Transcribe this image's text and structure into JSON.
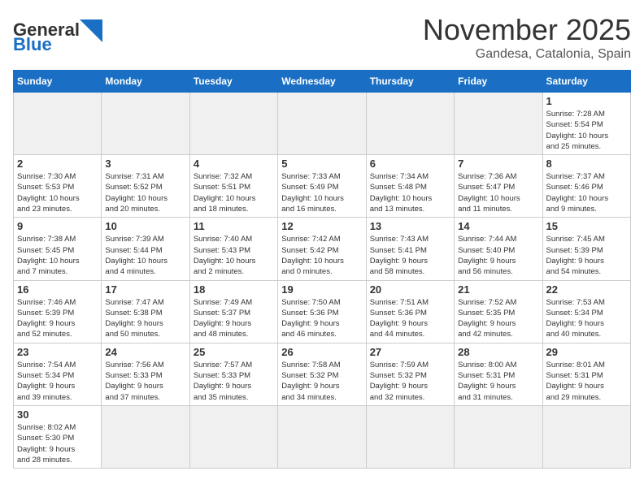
{
  "header": {
    "logo_general": "General",
    "logo_blue": "Blue",
    "month": "November 2025",
    "location": "Gandesa, Catalonia, Spain"
  },
  "weekdays": [
    "Sunday",
    "Monday",
    "Tuesday",
    "Wednesday",
    "Thursday",
    "Friday",
    "Saturday"
  ],
  "weeks": [
    [
      {
        "day": "",
        "info": "",
        "empty": true
      },
      {
        "day": "",
        "info": "",
        "empty": true
      },
      {
        "day": "",
        "info": "",
        "empty": true
      },
      {
        "day": "",
        "info": "",
        "empty": true
      },
      {
        "day": "",
        "info": "",
        "empty": true
      },
      {
        "day": "",
        "info": "",
        "empty": true
      },
      {
        "day": "1",
        "info": "Sunrise: 7:28 AM\nSunset: 5:54 PM\nDaylight: 10 hours\nand 25 minutes."
      }
    ],
    [
      {
        "day": "2",
        "info": "Sunrise: 7:30 AM\nSunset: 5:53 PM\nDaylight: 10 hours\nand 23 minutes."
      },
      {
        "day": "3",
        "info": "Sunrise: 7:31 AM\nSunset: 5:52 PM\nDaylight: 10 hours\nand 20 minutes."
      },
      {
        "day": "4",
        "info": "Sunrise: 7:32 AM\nSunset: 5:51 PM\nDaylight: 10 hours\nand 18 minutes."
      },
      {
        "day": "5",
        "info": "Sunrise: 7:33 AM\nSunset: 5:49 PM\nDaylight: 10 hours\nand 16 minutes."
      },
      {
        "day": "6",
        "info": "Sunrise: 7:34 AM\nSunset: 5:48 PM\nDaylight: 10 hours\nand 13 minutes."
      },
      {
        "day": "7",
        "info": "Sunrise: 7:36 AM\nSunset: 5:47 PM\nDaylight: 10 hours\nand 11 minutes."
      },
      {
        "day": "8",
        "info": "Sunrise: 7:37 AM\nSunset: 5:46 PM\nDaylight: 10 hours\nand 9 minutes."
      }
    ],
    [
      {
        "day": "9",
        "info": "Sunrise: 7:38 AM\nSunset: 5:45 PM\nDaylight: 10 hours\nand 7 minutes."
      },
      {
        "day": "10",
        "info": "Sunrise: 7:39 AM\nSunset: 5:44 PM\nDaylight: 10 hours\nand 4 minutes."
      },
      {
        "day": "11",
        "info": "Sunrise: 7:40 AM\nSunset: 5:43 PM\nDaylight: 10 hours\nand 2 minutes."
      },
      {
        "day": "12",
        "info": "Sunrise: 7:42 AM\nSunset: 5:42 PM\nDaylight: 10 hours\nand 0 minutes."
      },
      {
        "day": "13",
        "info": "Sunrise: 7:43 AM\nSunset: 5:41 PM\nDaylight: 9 hours\nand 58 minutes."
      },
      {
        "day": "14",
        "info": "Sunrise: 7:44 AM\nSunset: 5:40 PM\nDaylight: 9 hours\nand 56 minutes."
      },
      {
        "day": "15",
        "info": "Sunrise: 7:45 AM\nSunset: 5:39 PM\nDaylight: 9 hours\nand 54 minutes."
      }
    ],
    [
      {
        "day": "16",
        "info": "Sunrise: 7:46 AM\nSunset: 5:39 PM\nDaylight: 9 hours\nand 52 minutes."
      },
      {
        "day": "17",
        "info": "Sunrise: 7:47 AM\nSunset: 5:38 PM\nDaylight: 9 hours\nand 50 minutes."
      },
      {
        "day": "18",
        "info": "Sunrise: 7:49 AM\nSunset: 5:37 PM\nDaylight: 9 hours\nand 48 minutes."
      },
      {
        "day": "19",
        "info": "Sunrise: 7:50 AM\nSunset: 5:36 PM\nDaylight: 9 hours\nand 46 minutes."
      },
      {
        "day": "20",
        "info": "Sunrise: 7:51 AM\nSunset: 5:36 PM\nDaylight: 9 hours\nand 44 minutes."
      },
      {
        "day": "21",
        "info": "Sunrise: 7:52 AM\nSunset: 5:35 PM\nDaylight: 9 hours\nand 42 minutes."
      },
      {
        "day": "22",
        "info": "Sunrise: 7:53 AM\nSunset: 5:34 PM\nDaylight: 9 hours\nand 40 minutes."
      }
    ],
    [
      {
        "day": "23",
        "info": "Sunrise: 7:54 AM\nSunset: 5:34 PM\nDaylight: 9 hours\nand 39 minutes."
      },
      {
        "day": "24",
        "info": "Sunrise: 7:56 AM\nSunset: 5:33 PM\nDaylight: 9 hours\nand 37 minutes."
      },
      {
        "day": "25",
        "info": "Sunrise: 7:57 AM\nSunset: 5:33 PM\nDaylight: 9 hours\nand 35 minutes."
      },
      {
        "day": "26",
        "info": "Sunrise: 7:58 AM\nSunset: 5:32 PM\nDaylight: 9 hours\nand 34 minutes."
      },
      {
        "day": "27",
        "info": "Sunrise: 7:59 AM\nSunset: 5:32 PM\nDaylight: 9 hours\nand 32 minutes."
      },
      {
        "day": "28",
        "info": "Sunrise: 8:00 AM\nSunset: 5:31 PM\nDaylight: 9 hours\nand 31 minutes."
      },
      {
        "day": "29",
        "info": "Sunrise: 8:01 AM\nSunset: 5:31 PM\nDaylight: 9 hours\nand 29 minutes."
      }
    ],
    [
      {
        "day": "30",
        "info": "Sunrise: 8:02 AM\nSunset: 5:30 PM\nDaylight: 9 hours\nand 28 minutes.",
        "last": true
      },
      {
        "day": "",
        "info": "",
        "empty": true,
        "last": true
      },
      {
        "day": "",
        "info": "",
        "empty": true,
        "last": true
      },
      {
        "day": "",
        "info": "",
        "empty": true,
        "last": true
      },
      {
        "day": "",
        "info": "",
        "empty": true,
        "last": true
      },
      {
        "day": "",
        "info": "",
        "empty": true,
        "last": true
      },
      {
        "day": "",
        "info": "",
        "empty": true,
        "last": true
      }
    ]
  ]
}
